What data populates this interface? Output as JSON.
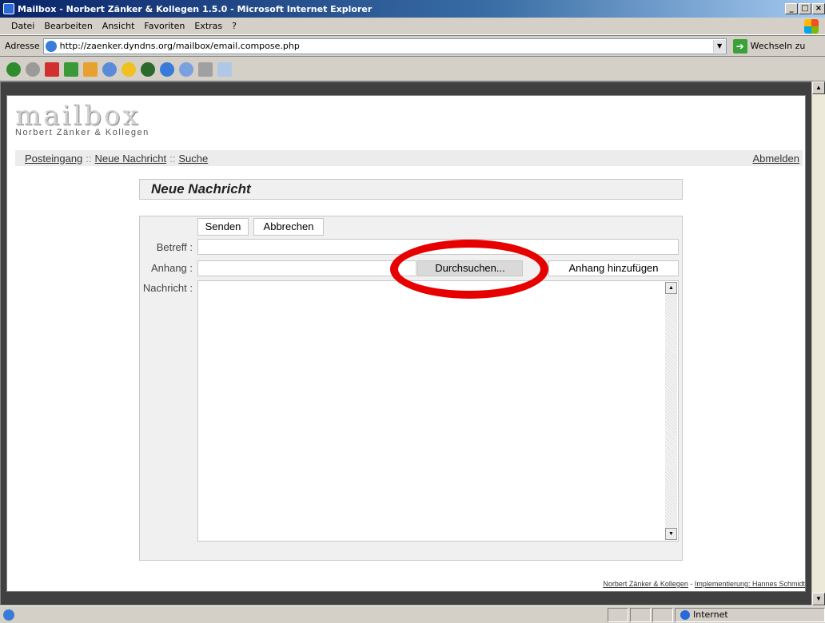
{
  "window": {
    "title": "Mailbox - Norbert Zänker & Kollegen 1.5.0 - Microsoft Internet Explorer",
    "min": "_",
    "max": "□",
    "close": "×"
  },
  "menu": [
    "Datei",
    "Bearbeiten",
    "Ansicht",
    "Favoriten",
    "Extras",
    "?"
  ],
  "address": {
    "label": "Adresse",
    "url": "http://zaenker.dyndns.org/mailbox/email.compose.php",
    "go_label": "Wechseln zu"
  },
  "toolbar_icons": [
    "back-icon",
    "forward-icon",
    "stop-icon",
    "refresh-icon",
    "home-icon",
    "search-icon",
    "favorites-icon",
    "media-icon",
    "history-icon",
    "mail-icon",
    "print-icon",
    "edit-icon"
  ],
  "app": {
    "logo": "mailbox",
    "company": "Norbert Zänker & Kollegen"
  },
  "nav": {
    "inbox": "Posteingang",
    "sep": "::",
    "new": "Neue Nachricht",
    "search": "Suche",
    "logout": "Abmelden"
  },
  "compose": {
    "heading": "Neue Nachricht",
    "send": "Senden",
    "cancel": "Abbrechen",
    "subject_label": "Betreff :",
    "subject_value": "",
    "attach_label": "Anhang :",
    "attach_value": "",
    "browse": "Durchsuchen...",
    "add_attachment": "Anhang hinzufügen",
    "message_label": "Nachricht :"
  },
  "footer": {
    "company": "Norbert Zänker & Kollegen",
    "sep": " - ",
    "impl": "Implementierung: Hannes Schmidt"
  },
  "status": {
    "zone": "Internet"
  },
  "colors": {
    "highlight_circle": "#e60000",
    "titlebar": "#0a246a"
  }
}
